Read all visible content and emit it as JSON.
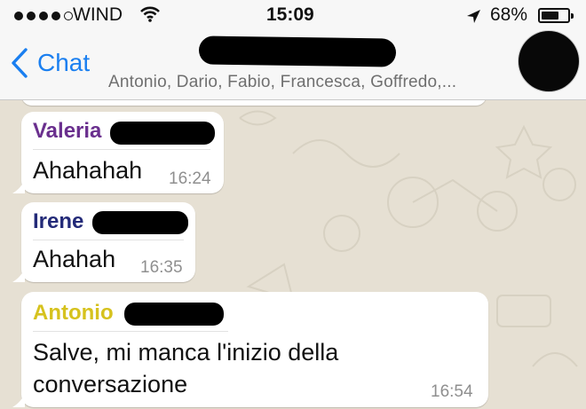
{
  "status_bar": {
    "carrier": "WIND",
    "time": "15:09",
    "battery_percent_label": "68%",
    "battery_level": 0.68,
    "signal_dots_filled": 4,
    "icons": [
      "signal-dots-icon",
      "wifi-icon",
      "location-arrow-icon",
      "battery-icon"
    ]
  },
  "nav": {
    "back_label": "Chat",
    "members": "Antonio, Dario, Fabio, Francesca, Goffredo,...",
    "accent": "#1a7ff0"
  },
  "messages": [
    {
      "sender": "Valeria",
      "sender_color": "#6a2f8e",
      "text": "Ahahahah",
      "time": "16:24"
    },
    {
      "sender": "Irene",
      "sender_color": "#232a78",
      "text": "Ahahah",
      "time": "16:35"
    },
    {
      "sender": "Antonio",
      "sender_color": "#d6c21e",
      "text_line1": "Salve, mi manca l'inizio della",
      "text_line2": "conversazione",
      "time": "16:54"
    }
  ]
}
